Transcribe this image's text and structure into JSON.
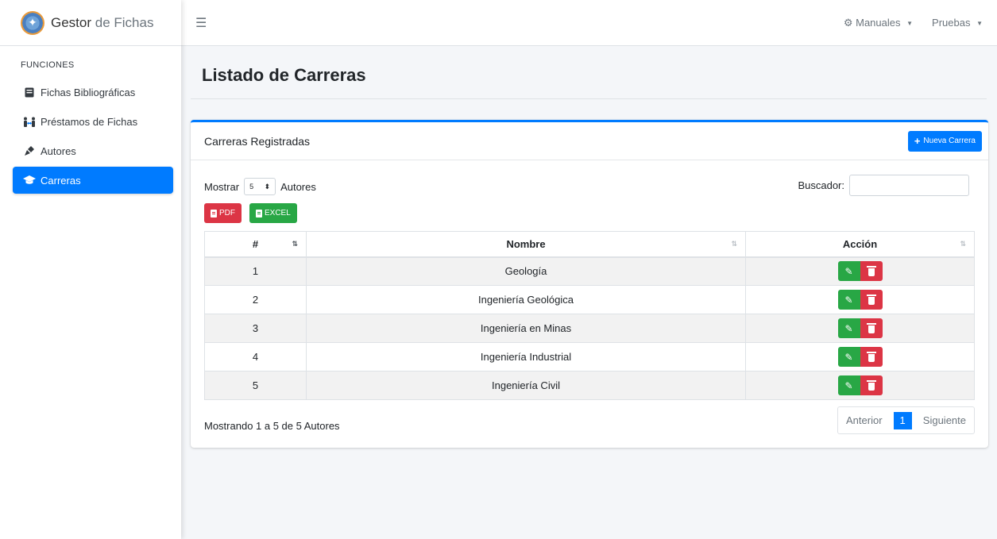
{
  "brand": {
    "name_bold": "Gestor",
    "name_light": "de Fichas"
  },
  "sidebar": {
    "header": "FUNCIONES",
    "items": [
      {
        "label": "Fichas Bibliográficas",
        "icon": "book-icon"
      },
      {
        "label": "Préstamos de Fichas",
        "icon": "people-arrows-icon"
      },
      {
        "label": "Autores",
        "icon": "pen-nib-icon"
      },
      {
        "label": "Carreras",
        "icon": "graduation-cap-icon",
        "active": true
      }
    ]
  },
  "topbar": {
    "manuals_label": "Manuales",
    "user_label": "Pruebas"
  },
  "page": {
    "title": "Listado de Carreras"
  },
  "card": {
    "title": "Carreras Registradas",
    "new_button": "Nueva Carrera",
    "length": {
      "prefix": "Mostrar",
      "value": "5",
      "suffix": "Autores"
    },
    "search_label": "Buscador:",
    "search_value": "",
    "export_pdf": "PDF",
    "export_excel": "EXCEL",
    "columns": [
      "#",
      "Nombre",
      "Acción"
    ],
    "rows": [
      {
        "num": "1",
        "name": "Geología"
      },
      {
        "num": "2",
        "name": "Ingeniería Geológica"
      },
      {
        "num": "3",
        "name": "Ingeniería en Minas"
      },
      {
        "num": "4",
        "name": "Ingeniería Industrial"
      },
      {
        "num": "5",
        "name": "Ingeniería Civil"
      }
    ],
    "info": "Mostrando 1 a 5 de 5 Autores",
    "pager": {
      "prev": "Anterior",
      "current": "1",
      "next": "Siguiente"
    }
  },
  "colors": {
    "primary": "#007bff",
    "success": "#28a745",
    "danger": "#dc3545"
  }
}
